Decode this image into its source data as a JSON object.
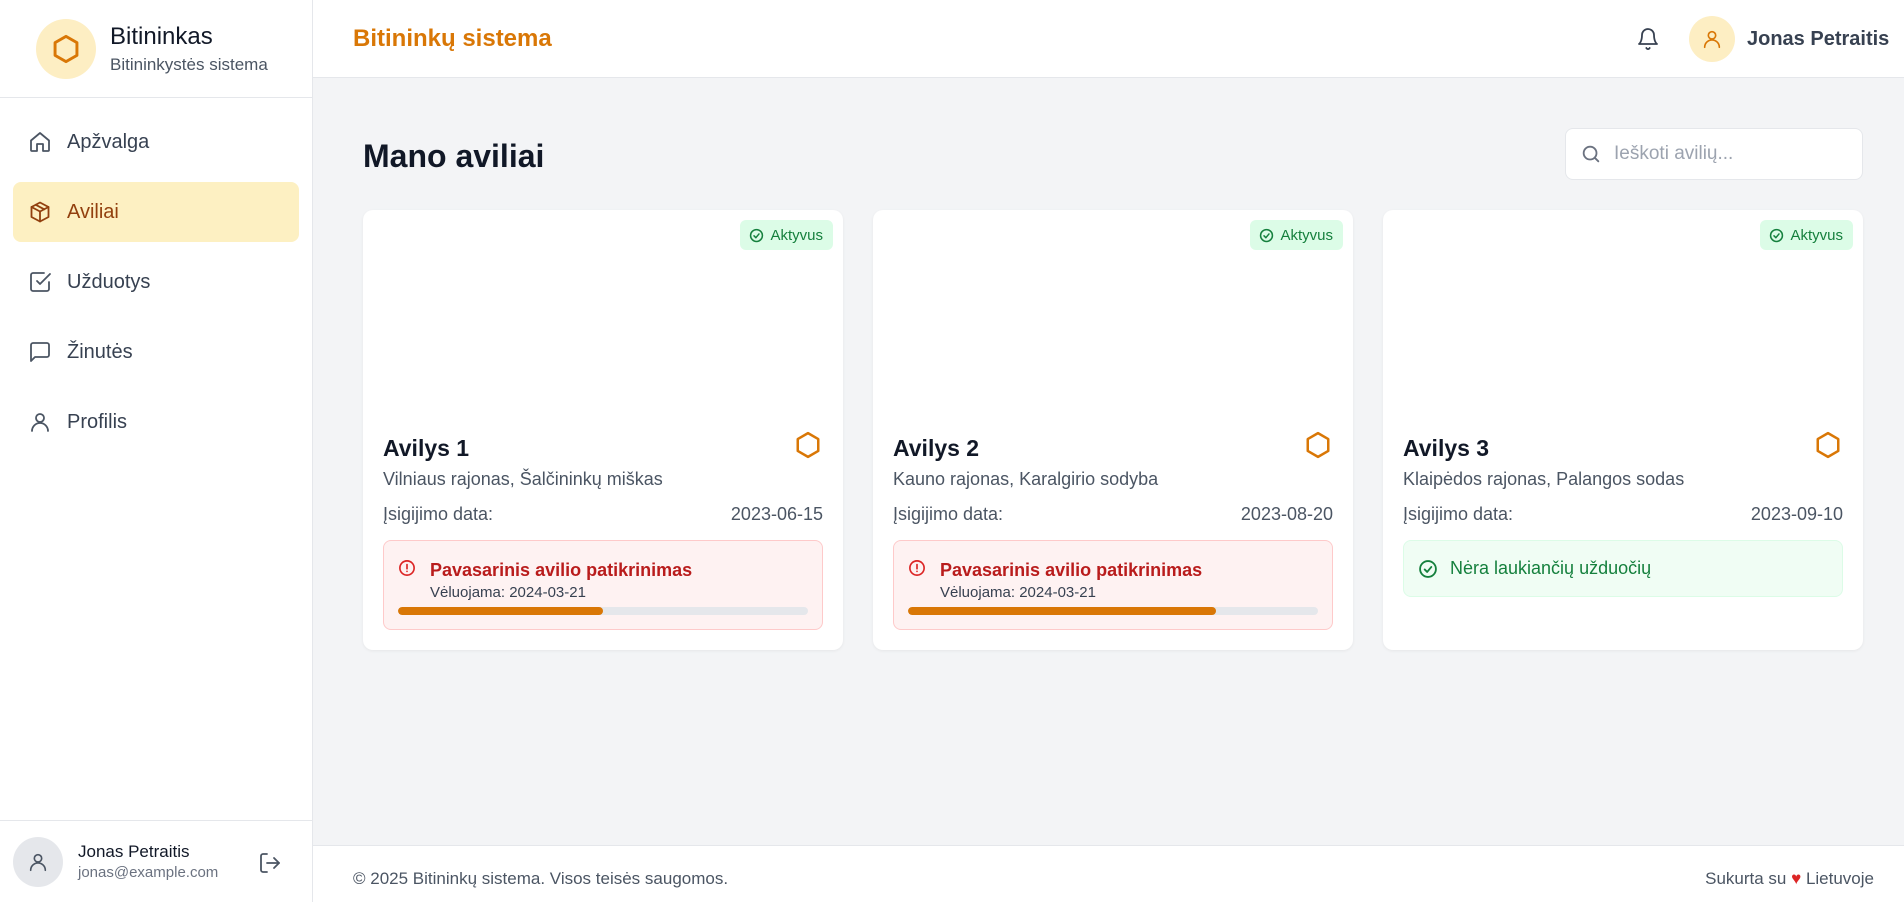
{
  "brand": {
    "title": "Bitininkas",
    "subtitle": "Bitininkystės sistema"
  },
  "sidebar": {
    "items": [
      {
        "label": "Apžvalga",
        "icon": "home-icon"
      },
      {
        "label": "Aviliai",
        "icon": "box-icon",
        "active": true
      },
      {
        "label": "Užduotys",
        "icon": "check-square-icon"
      },
      {
        "label": "Žinutės",
        "icon": "message-icon"
      },
      {
        "label": "Profilis",
        "icon": "user-icon"
      }
    ],
    "user": {
      "name": "Jonas Petraitis",
      "email": "jonas@example.com"
    }
  },
  "header": {
    "title": "Bitininkų sistema",
    "username": "Jonas Petraitis"
  },
  "main": {
    "title": "Mano aviliai",
    "search_placeholder": "Ieškoti avilių...",
    "date_label": "Įsigijimo data:",
    "hives": [
      {
        "name": "Avilys 1",
        "location": "Vilniaus rajonas, Šalčininkų miškas",
        "date": "2023-06-15",
        "status": "Aktyvus",
        "task": {
          "title": "Pavasarinis avilio patikrinimas",
          "due": "Vėluojama: 2024-03-21",
          "progress": 0.5
        }
      },
      {
        "name": "Avilys 2",
        "location": "Kauno rajonas, Karalgirio sodyba",
        "date": "2023-08-20",
        "status": "Aktyvus",
        "task": {
          "title": "Pavasarinis avilio patikrinimas",
          "due": "Vėluojama: 2024-03-21",
          "progress": 0.75
        }
      },
      {
        "name": "Avilys 3",
        "location": "Klaipėdos rajonas, Palangos sodas",
        "date": "2023-09-10",
        "status": "Aktyvus",
        "no_tasks": "Nėra laukiančių užduočių"
      }
    ]
  },
  "footer": {
    "copyright": "© 2025 Bitininkų sistema. Visos teisės saugomos.",
    "made_prefix": "Sukurta su",
    "heart": "♥",
    "made_suffix": "Lietuvoje"
  },
  "colors": {
    "accent": "#d97706",
    "active_bg": "#fdf0c2",
    "success": "#15803d",
    "danger": "#b91c1c"
  }
}
